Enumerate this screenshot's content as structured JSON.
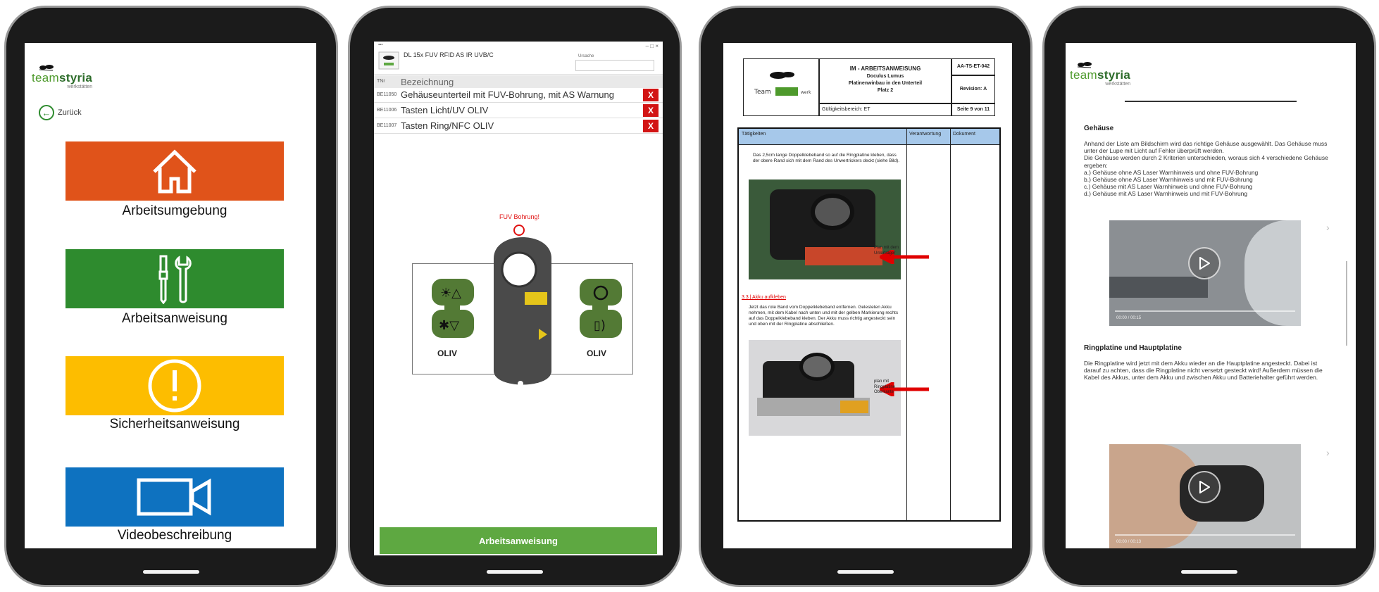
{
  "phone1": {
    "logo": {
      "part1": "team",
      "part2": "styria",
      "sub": "werkstätten"
    },
    "back_label": "Zurück",
    "tiles": [
      {
        "label": "Arbeitsumgebung",
        "color": "#e0531a",
        "icon": "home-icon"
      },
      {
        "label": "Arbeitsanweisung",
        "color": "#2e8b2e",
        "icon": "tools-icon"
      },
      {
        "label": "Sicherheitsanweisung",
        "color": "#fdbd00",
        "icon": "exclamation-icon"
      },
      {
        "label": "Videobeschreibung",
        "color": "#0e72c0",
        "icon": "video-camera-icon"
      }
    ]
  },
  "phone2": {
    "window_title": "DL 15x FUV RFID AS IR UVB/C",
    "field_label": "Ursache",
    "header_code": "TNr",
    "header_name": "Bezeichnung",
    "rows": [
      {
        "code": "BE11050",
        "name": "Gehäuseunterteil mit FUV-Bohrung, mit AS Warnung"
      },
      {
        "code": "BE11006",
        "name": "Tasten Licht/UV OLIV"
      },
      {
        "code": "BE11007",
        "name": "Tasten Ring/NFC OLIV"
      }
    ],
    "remove_label": "X",
    "fuv_label": "FUV Bohrung!",
    "left_part_label": "OLIV",
    "right_part_label": "OLIV",
    "bottom_button": "Arbeitsanweisung",
    "accent": "#5ea841"
  },
  "phone3": {
    "doc_title": "IM - ARBEITSANWEISUNG",
    "doc_subtitle1": "Doculus Lumus",
    "doc_subtitle2": "Platinenwinbau in den Unterteil",
    "doc_subtitle3": "Platz 2",
    "doc_id": "AA-TS-ET-042",
    "revision": "Revision: A",
    "validity": "Gültigkeitsbereich: ET",
    "page": "Seite 9 von 11",
    "col1": "Tätigkeiten",
    "col2": "Verantwortung",
    "col3": "Dokument",
    "step1_text": "Das 2,5cm lange Doppelklebeband so auf die Ringplatine kleben, dass der obere Rand sich mit dem Rand des Unwertrickers deckt (siehe Bild).",
    "step1_note": "Plan mit dem Unterträger",
    "step2_title": "3.3 | Akku aufkleben",
    "step2_text": "Jetzt das rote Band vom Doppelklebeband entfernen. Gelesteten Akku nehmen, mit dem Kabel nach unten und mit der gelben Markierung rechts auf das Doppelklebeband kleben. Der Akku muss richtig angesteckt sein und oben mit der Ringplatine abschließen.",
    "step2_note": "plan mit Ringplatine Oberkante"
  },
  "phone4": {
    "logo": {
      "part1": "team",
      "part2": "styria",
      "sub": "werkstätten"
    },
    "section1_title": "Gehäuse",
    "section1_text": "Anhand der Liste am Bildschirm wird das richtige Gehäuse ausgewählt. Das Gehäuse muss unter der Lupe mit Licht auf Fehler überprüft werden.\nDie Gehäuse werden durch 2 Kriterien unterschieden, woraus sich 4 verschiedene Gehäuse ergeben:\na.) Gehäuse ohne AS Laser Warnhinweis und ohne FUV-Bohrung\nb.) Gehäuse ohne AS Laser Warnhinweis und mit FUV-Bohrung\nc.) Gehäuse mit AS Laser Warnhinweis und ohne FUV-Bohrung\nd.) Gehäuse mit AS Laser Warnhinweis und mit FUV-Bohrung",
    "video1_time": "00:00 / 00:15",
    "section2_title": "Ringplatine und Hauptplatine",
    "section2_text": "Die Ringplatine wird jetzt mit dem Akku wieder an die Hauptplatine angesteckt. Dabei ist darauf zu achten, dass die Ringplatine nicht versetzt gesteckt wird! Außerdem müssen die Kabel des Akkus, unter dem Akku und zwischen Akku und Batteriehalter geführt werden.",
    "video2_time": "00:00 / 00:13"
  }
}
